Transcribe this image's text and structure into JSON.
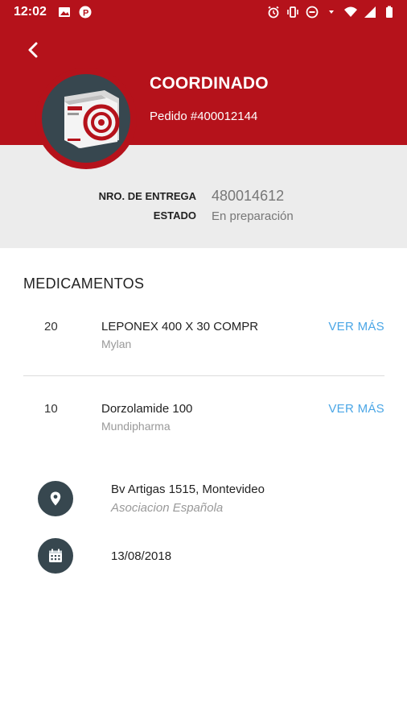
{
  "status_bar": {
    "time": "12:02"
  },
  "header": {
    "title": "COORDINADO",
    "subtitle": "Pedido #400012144",
    "color": "#b5121b"
  },
  "info": {
    "delivery_label": "NRO. DE ENTREGA",
    "delivery_value": "480014612",
    "status_label": "ESTADO",
    "status_value": "En preparación"
  },
  "medicamentos": {
    "title": "MEDICAMENTOS",
    "items": [
      {
        "qty": "20",
        "name": "LEPONEX 400 X 30 COMPR",
        "lab": "Mylan",
        "link": "VER MÁS"
      },
      {
        "qty": "10",
        "name": "Dorzolamide 100",
        "lab": "Mundipharma",
        "link": "VER MÁS"
      }
    ]
  },
  "details": {
    "address": "Bv Artigas 1515, Montevideo",
    "place": "Asociacion Española",
    "date": "13/08/2018",
    "icon_color": "#37474f"
  },
  "icons": [
    "back-icon",
    "location-pin-icon",
    "calendar-icon",
    "medicine-box-icon"
  ]
}
